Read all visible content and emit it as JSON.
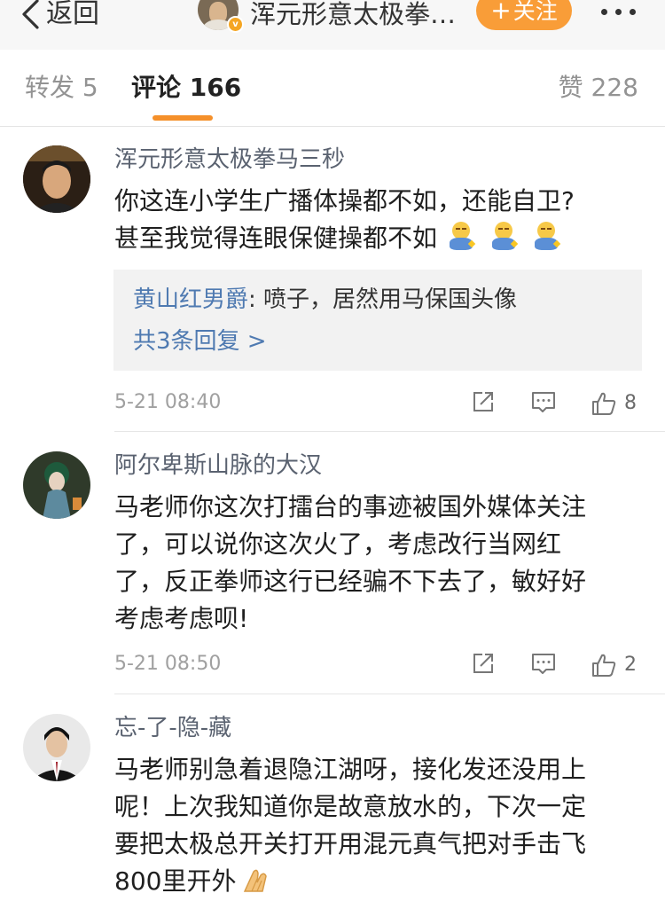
{
  "nav": {
    "back_label": "返回",
    "title": "浑元形意太极拳…",
    "follow_label": "关注",
    "follow_plus": "+",
    "verified_mark": "v",
    "accent_color": "#f99d38"
  },
  "tabs": {
    "repost": "转发 5",
    "comments": "评论 166",
    "likes": "赞 228",
    "active": "comments",
    "active_color": "#f5902a"
  },
  "comments": [
    {
      "username": "浑元形意太极拳马三秒",
      "text_lines": [
        "你这连小学生广播体操都不如，还能自卫?",
        "甚至我觉得连眼保健操都不如"
      ],
      "emoji": [
        "sleepy-emoji",
        "sleepy-emoji",
        "sleepy-emoji"
      ],
      "reply": {
        "user": "黄山红男爵",
        "text": ": 喷子，居然用马保国头像",
        "more": "共3条回复 >"
      },
      "time": "5-21 08:40",
      "likes": "8"
    },
    {
      "username": "阿尔卑斯山脉的大汉",
      "text_lines": [
        "马老师你这次打擂台的事迹被国外媒体关注",
        "了，可以说你这次火了，考虑改行当网红",
        "了，反正拳师这行已经骗不下去了，敏好好",
        "考虑考虑呗!"
      ],
      "time": "5-21 08:50",
      "likes": "2"
    },
    {
      "username": "忘-了-隐-藏",
      "text_lines": [
        "马老师别急着退隐江湖呀，接化发还没用上",
        "呢！上次我知道你是故意放水的，下次一定",
        "要把太极总开关打开用混元真气把对手击飞",
        "800里开外"
      ],
      "emoji": [
        "praying-hands-emoji"
      ]
    }
  ],
  "icons": {
    "share": "share-icon",
    "comment": "comment-icon",
    "like": "thumbs-up-icon",
    "back": "chevron-left-icon",
    "more": "more-dots-icon"
  }
}
